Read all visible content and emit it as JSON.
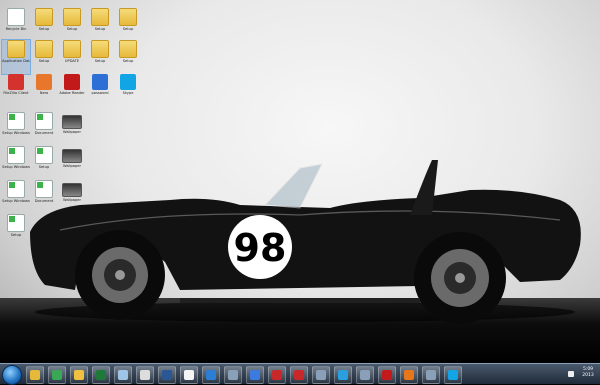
{
  "desktop": {
    "icons": [
      {
        "label": "Recycle Bin",
        "kind": "doc"
      },
      {
        "label": "Setup",
        "kind": "folder"
      },
      {
        "label": "Setup",
        "kind": "folder"
      },
      {
        "label": "Setup",
        "kind": "folder"
      },
      {
        "label": "Setup",
        "kind": "folder"
      },
      {
        "label": "Application Data",
        "kind": "folder"
      },
      {
        "label": "Setup",
        "kind": "folder"
      },
      {
        "label": "UPDATE",
        "kind": "folder"
      },
      {
        "label": "Setup",
        "kind": "folder"
      },
      {
        "label": "Setup",
        "kind": "folder"
      },
      {
        "label": "FileZilla Client",
        "kind": "app"
      },
      {
        "label": "Nero",
        "kind": "app"
      },
      {
        "label": "Adobe Reader",
        "kind": "app"
      },
      {
        "label": "password",
        "kind": "app"
      },
      {
        "label": "Skype",
        "kind": "app"
      },
      {
        "label": "Setup Windows",
        "kind": "doc"
      },
      {
        "label": "Document",
        "kind": "doc"
      },
      {
        "label": "Wallpaper",
        "kind": "image"
      },
      {
        "label": "Setup Windows",
        "kind": "doc"
      },
      {
        "label": "Setup",
        "kind": "doc"
      },
      {
        "label": "Wallpaper",
        "kind": "image"
      },
      {
        "label": "Setup Windows",
        "kind": "doc"
      },
      {
        "label": "Document",
        "kind": "doc"
      },
      {
        "label": "Wallpaper",
        "kind": "image"
      },
      {
        "label": "Setup",
        "kind": "doc"
      }
    ],
    "wallpaper_number": "98"
  },
  "taskbar": {
    "items": [
      "folder-icon",
      "chrome-icon",
      "explorer-icon",
      "excel-icon",
      "notepad-icon",
      "chess-icon",
      "word-icon",
      "document-icon",
      "windows-icon",
      "generic-icon",
      "media-icon",
      "red-app-icon",
      "red-app-icon",
      "generic-icon",
      "ie-icon",
      "generic-icon",
      "filezilla-icon",
      "firefox-icon",
      "generic-icon",
      "skype-icon"
    ],
    "clock_time": "5:09",
    "clock_date": "2013"
  },
  "colors": {
    "taskbar": "#1e2a38",
    "folder": "#e6b93a",
    "car_body": "#121212",
    "roundel": "#ffffff"
  }
}
